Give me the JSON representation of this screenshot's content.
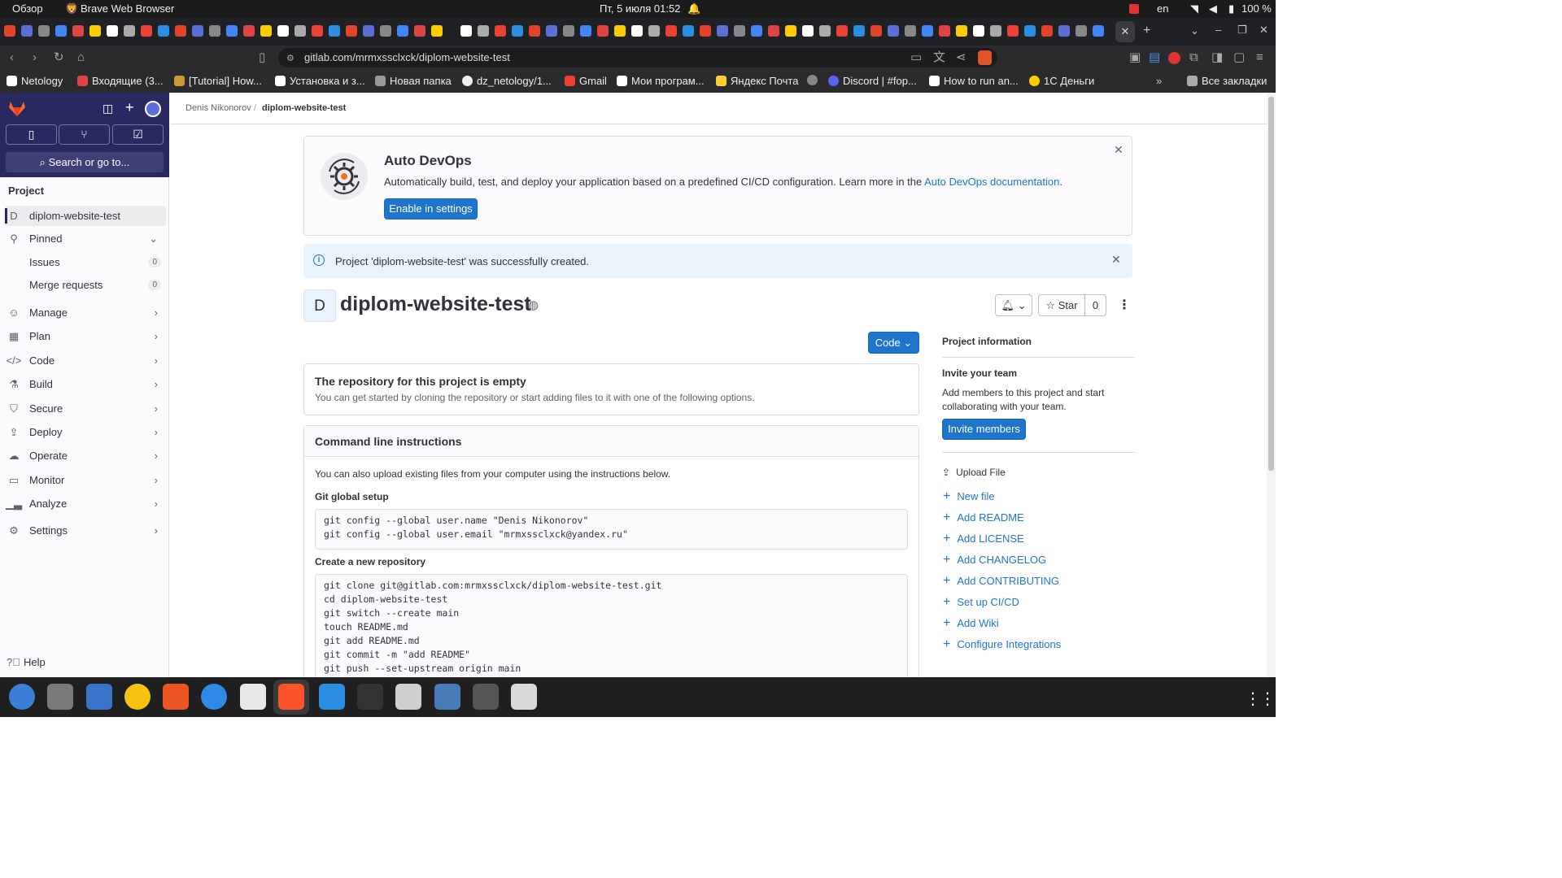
{
  "system": {
    "overview": "Обзор",
    "app_name": "Brave Web Browser",
    "datetime": "Пт, 5 июля  01:52",
    "lang": "en",
    "battery": "100 %"
  },
  "browser": {
    "url": "gitlab.com/mrmxssclxck/diplom-website-test",
    "bookmarks": [
      "Netology",
      "Входящие (3...",
      "[Tutorial] How...",
      "Установка и з...",
      "Новая папка",
      "dz_netology/1...",
      "Gmail",
      "Мои програм...",
      "Яндекс Почта",
      "Discord | #fop...",
      "How to run an...",
      "1С Деньги"
    ],
    "all_bookmarks": "Все закладки"
  },
  "sidebar": {
    "search": "Search or go to...",
    "section": "Project",
    "project_letter": "D",
    "project_name": "diplom-website-test",
    "pinned": "Pinned",
    "pinned_items": [
      {
        "label": "Issues",
        "count": "0"
      },
      {
        "label": "Merge requests",
        "count": "0"
      }
    ],
    "nav": [
      "Manage",
      "Plan",
      "Code",
      "Build",
      "Secure",
      "Deploy",
      "Operate",
      "Monitor",
      "Analyze",
      "Settings"
    ],
    "help": "Help"
  },
  "breadcrumb": {
    "owner": "Denis Nikonorov",
    "sep": "/",
    "project": "diplom-website-test"
  },
  "devops": {
    "title": "Auto DevOps",
    "text": "Automatically build, test, and deploy your application based on a predefined CI/CD configuration. Learn more in the ",
    "link": "Auto DevOps documentation",
    "tail": ".",
    "button": "Enable in settings"
  },
  "alert": {
    "text": "Project 'diplom-website-test' was successfully created."
  },
  "project": {
    "avatar": "D",
    "title": "diplom-website-test",
    "star_label": "Star",
    "star_count": "0",
    "code_button": "Code"
  },
  "empty": {
    "title": "The repository for this project is empty",
    "subtitle": "You can get started by cloning the repository or start adding files to it with one of the following options."
  },
  "cli": {
    "title": "Command line instructions",
    "intro": "You can also upload existing files from your computer using the instructions below.",
    "global_title": "Git global setup",
    "global_code": "git config --global user.name \"Denis Nikonorov\"\ngit config --global user.email \"mrmxssclxck@yandex.ru\"",
    "new_title": "Create a new repository",
    "new_code": "git clone git@gitlab.com:mrmxssclxck/diplom-website-test.git\ncd diplom-website-test\ngit switch --create main\ntouch README.md\ngit add README.md\ngit commit -m \"add README\"\ngit push --set-upstream origin main"
  },
  "info": {
    "title": "Project information",
    "invite_title": "Invite your team",
    "invite_text": "Add members to this project and start collaborating with your team.",
    "invite_button": "Invite members",
    "upload": "Upload File",
    "links": [
      "New file",
      "Add README",
      "Add LICENSE",
      "Add CHANGELOG",
      "Add CONTRIBUTING",
      "Set up CI/CD",
      "Add Wiki",
      "Configure Integrations"
    ]
  },
  "colors": {
    "sidebar_top": "#292961",
    "accent": "#1f75cb",
    "alert_bg": "#e9f3fc"
  }
}
